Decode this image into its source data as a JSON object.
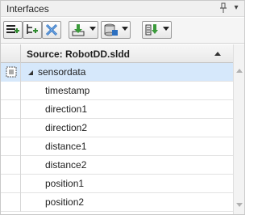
{
  "panel": {
    "title": "Interfaces",
    "pin_icon": "pin-icon",
    "menu_icon": "chevron-down-icon",
    "menu_glyph": "▾"
  },
  "toolbar": {
    "buttons": [
      {
        "name": "add-interface-button",
        "icon": "add-interface-icon"
      },
      {
        "name": "add-element-button",
        "icon": "add-element-icon"
      },
      {
        "name": "delete-button",
        "icon": "delete-icon"
      },
      {
        "name": "import-button",
        "icon": "import-icon",
        "has_dropdown": true
      },
      {
        "name": "dictionary-button",
        "icon": "dictionary-icon",
        "has_dropdown": true
      },
      {
        "name": "export-button",
        "icon": "export-icon",
        "has_dropdown": true
      }
    ]
  },
  "grid": {
    "header": "Source: RobotDD.sldd",
    "sort_direction": "ascending",
    "interface": {
      "name": "sensordata",
      "expanded": true,
      "icon": "interface-icon",
      "selected": true
    },
    "elements": [
      "timestamp",
      "direction1",
      "direction2",
      "distance1",
      "distance2",
      "position1",
      "position2"
    ]
  },
  "colors": {
    "selection": "#d6e8fb",
    "header_bg": "#ececec",
    "toolbar_bg": "#f5f5f5",
    "accent_blue": "#2c6fbf",
    "accent_green": "#3a9a3a"
  }
}
